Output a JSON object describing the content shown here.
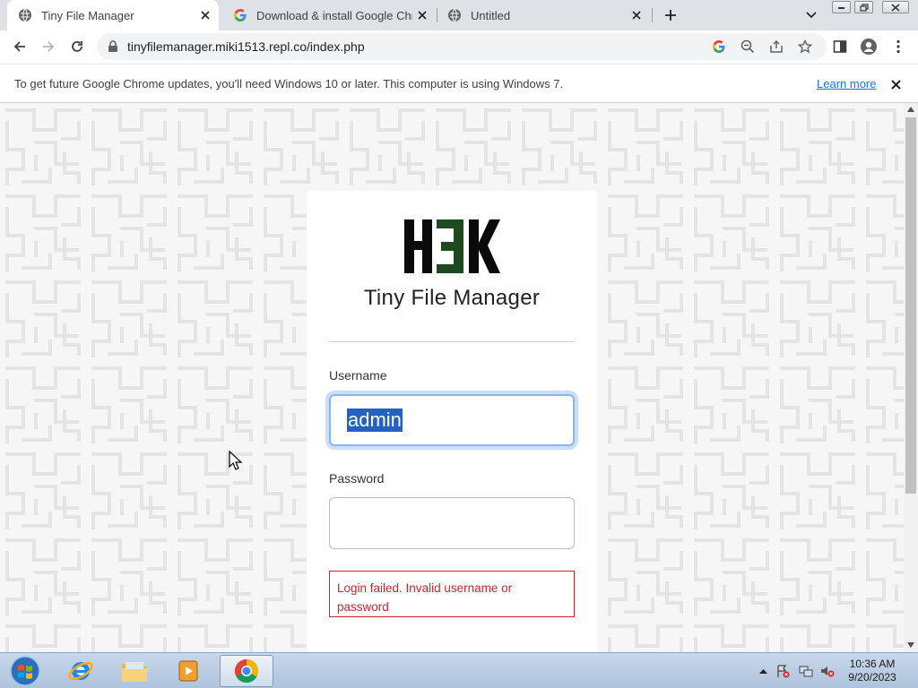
{
  "browser": {
    "tabs": [
      {
        "title": "Tiny File Manager",
        "favicon": "globe-icon",
        "active": true
      },
      {
        "title": "Download & install Google Chro",
        "favicon": "google-g-icon",
        "active": false
      },
      {
        "title": "Untitled",
        "favicon": "globe-icon",
        "active": false
      }
    ],
    "url": "tinyfilemanager.miki1513.repl.co/index.php"
  },
  "infobar": {
    "message": "To get future Google Chrome updates, you'll need Windows 10 or later. This computer is using Windows 7.",
    "link": "Learn more"
  },
  "login": {
    "logo_text": "H3K",
    "app_title": "Tiny File Manager",
    "username_label": "Username",
    "username_value": "admin",
    "password_label": "Password",
    "password_value": "",
    "error": "Login failed. Invalid username or password"
  },
  "taskbar": {
    "time": "10:36 AM",
    "date": "9/20/2023"
  },
  "colors": {
    "accent_blue": "#1a73e8",
    "error_red": "#c7262e",
    "logo_dark": "#0a0a0a",
    "logo_green": "#1f4a1f",
    "focus_ring": "#86b7fe"
  }
}
